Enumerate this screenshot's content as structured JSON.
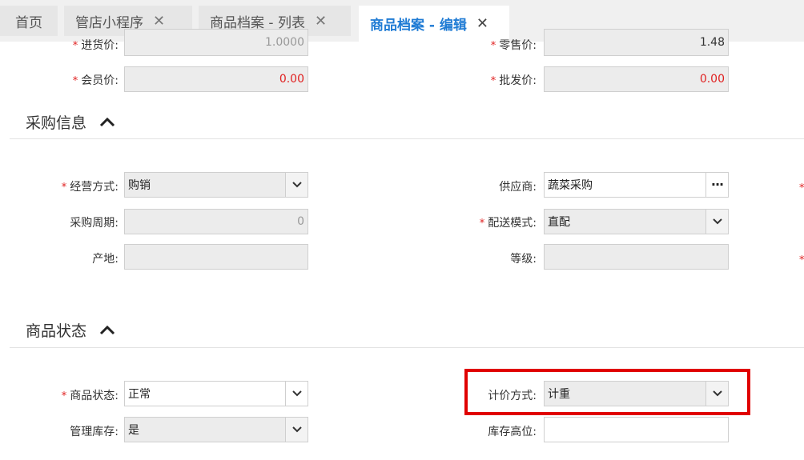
{
  "tabs": [
    {
      "label": "首页",
      "closable": false
    },
    {
      "label": "管店小程序",
      "closable": true
    },
    {
      "label": "商品档案 - 列表",
      "closable": true
    },
    {
      "label": "商品档案 - 编辑",
      "closable": true,
      "active": true
    }
  ],
  "close_glyph": "✕",
  "required_mark": "*",
  "price": {
    "purchase_price_label": "进货价:",
    "purchase_price_value": "1.0000",
    "retail_price_label": "零售价:",
    "retail_price_value": "1.48",
    "member_price_label": "会员价:",
    "member_price_value": "0.00",
    "wholesale_price_label": "批发价:",
    "wholesale_price_value": "0.00"
  },
  "purchase_section": {
    "title": "采购信息",
    "business_mode_label": "经营方式:",
    "business_mode_value": "购销",
    "supplier_label": "供应商:",
    "supplier_value": "蔬菜采购",
    "supplier_button": "···",
    "purchase_cycle_label": "采购周期:",
    "purchase_cycle_value": "0",
    "delivery_mode_label": "配送模式:",
    "delivery_mode_value": "直配",
    "origin_label": "产地:",
    "origin_value": "",
    "grade_label": "等级:",
    "grade_value": ""
  },
  "status_section": {
    "title": "商品状态",
    "status_label": "商品状态:",
    "status_value": "正常",
    "pricing_mode_label": "计价方式:",
    "pricing_mode_value": "计重",
    "manage_stock_label": "管理库存:",
    "manage_stock_value": "是",
    "stock_max_label": "库存高位:",
    "stock_max_value": ""
  },
  "colors": {
    "accent": "#1f7bd4",
    "required": "#e02020",
    "highlight_border": "#e00000"
  },
  "icons": {
    "close": "close-icon",
    "collapse": "chevron-up-icon",
    "dropdown": "chevron-down-icon",
    "more": "more-icon"
  }
}
